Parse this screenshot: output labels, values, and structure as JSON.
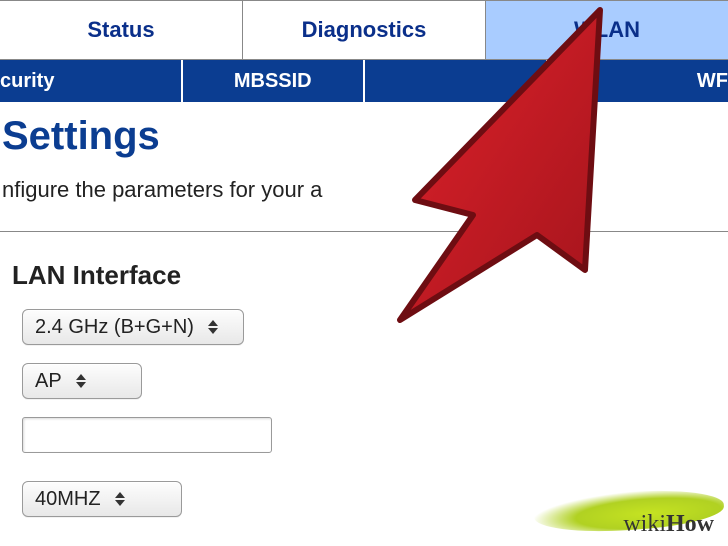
{
  "tabs_top": [
    {
      "label": "Status",
      "active": false
    },
    {
      "label": "Diagnostics",
      "active": false
    },
    {
      "label": "WLAN",
      "active": true
    }
  ],
  "tabs_sub": [
    {
      "label": "curity"
    },
    {
      "label": "MBSSID"
    },
    {
      "label": ""
    },
    {
      "label": "WF"
    }
  ],
  "title": "Settings",
  "description": "nfigure the parameters for your a",
  "section_title": "LAN Interface",
  "fields": {
    "band": {
      "value": "2.4 GHz (B+G+N)"
    },
    "mode": {
      "value": "AP"
    },
    "ssid": {
      "value": ""
    },
    "channel_width": {
      "value": "40MHZ"
    }
  },
  "watermark": {
    "brand_a": "wiki",
    "brand_b": "How"
  }
}
